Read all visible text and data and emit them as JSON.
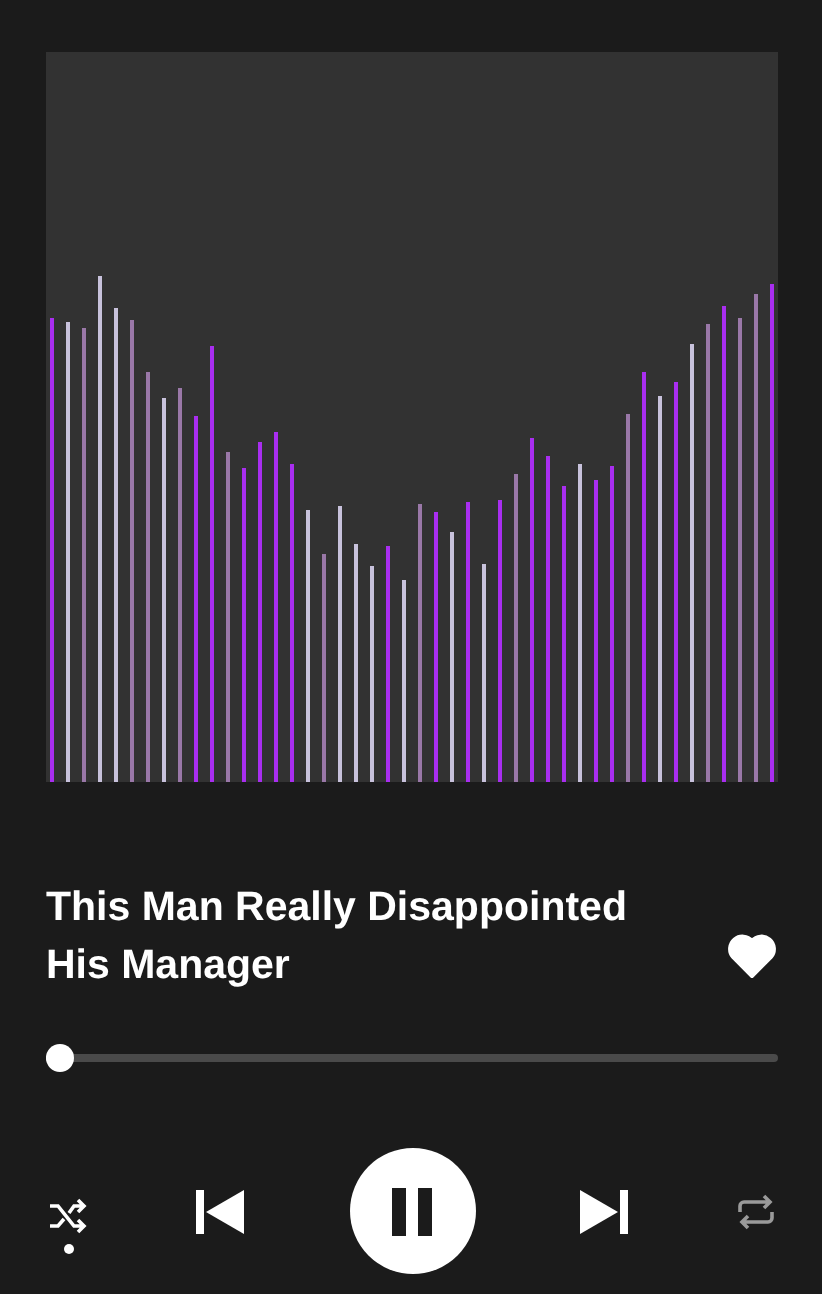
{
  "track": {
    "title": "This Man Really Disappointed His Manager",
    "liked": true
  },
  "progress": {
    "level": 0.02
  },
  "controls": {
    "shuffle_on": true,
    "playing": true,
    "repeat_on": false
  }
}
